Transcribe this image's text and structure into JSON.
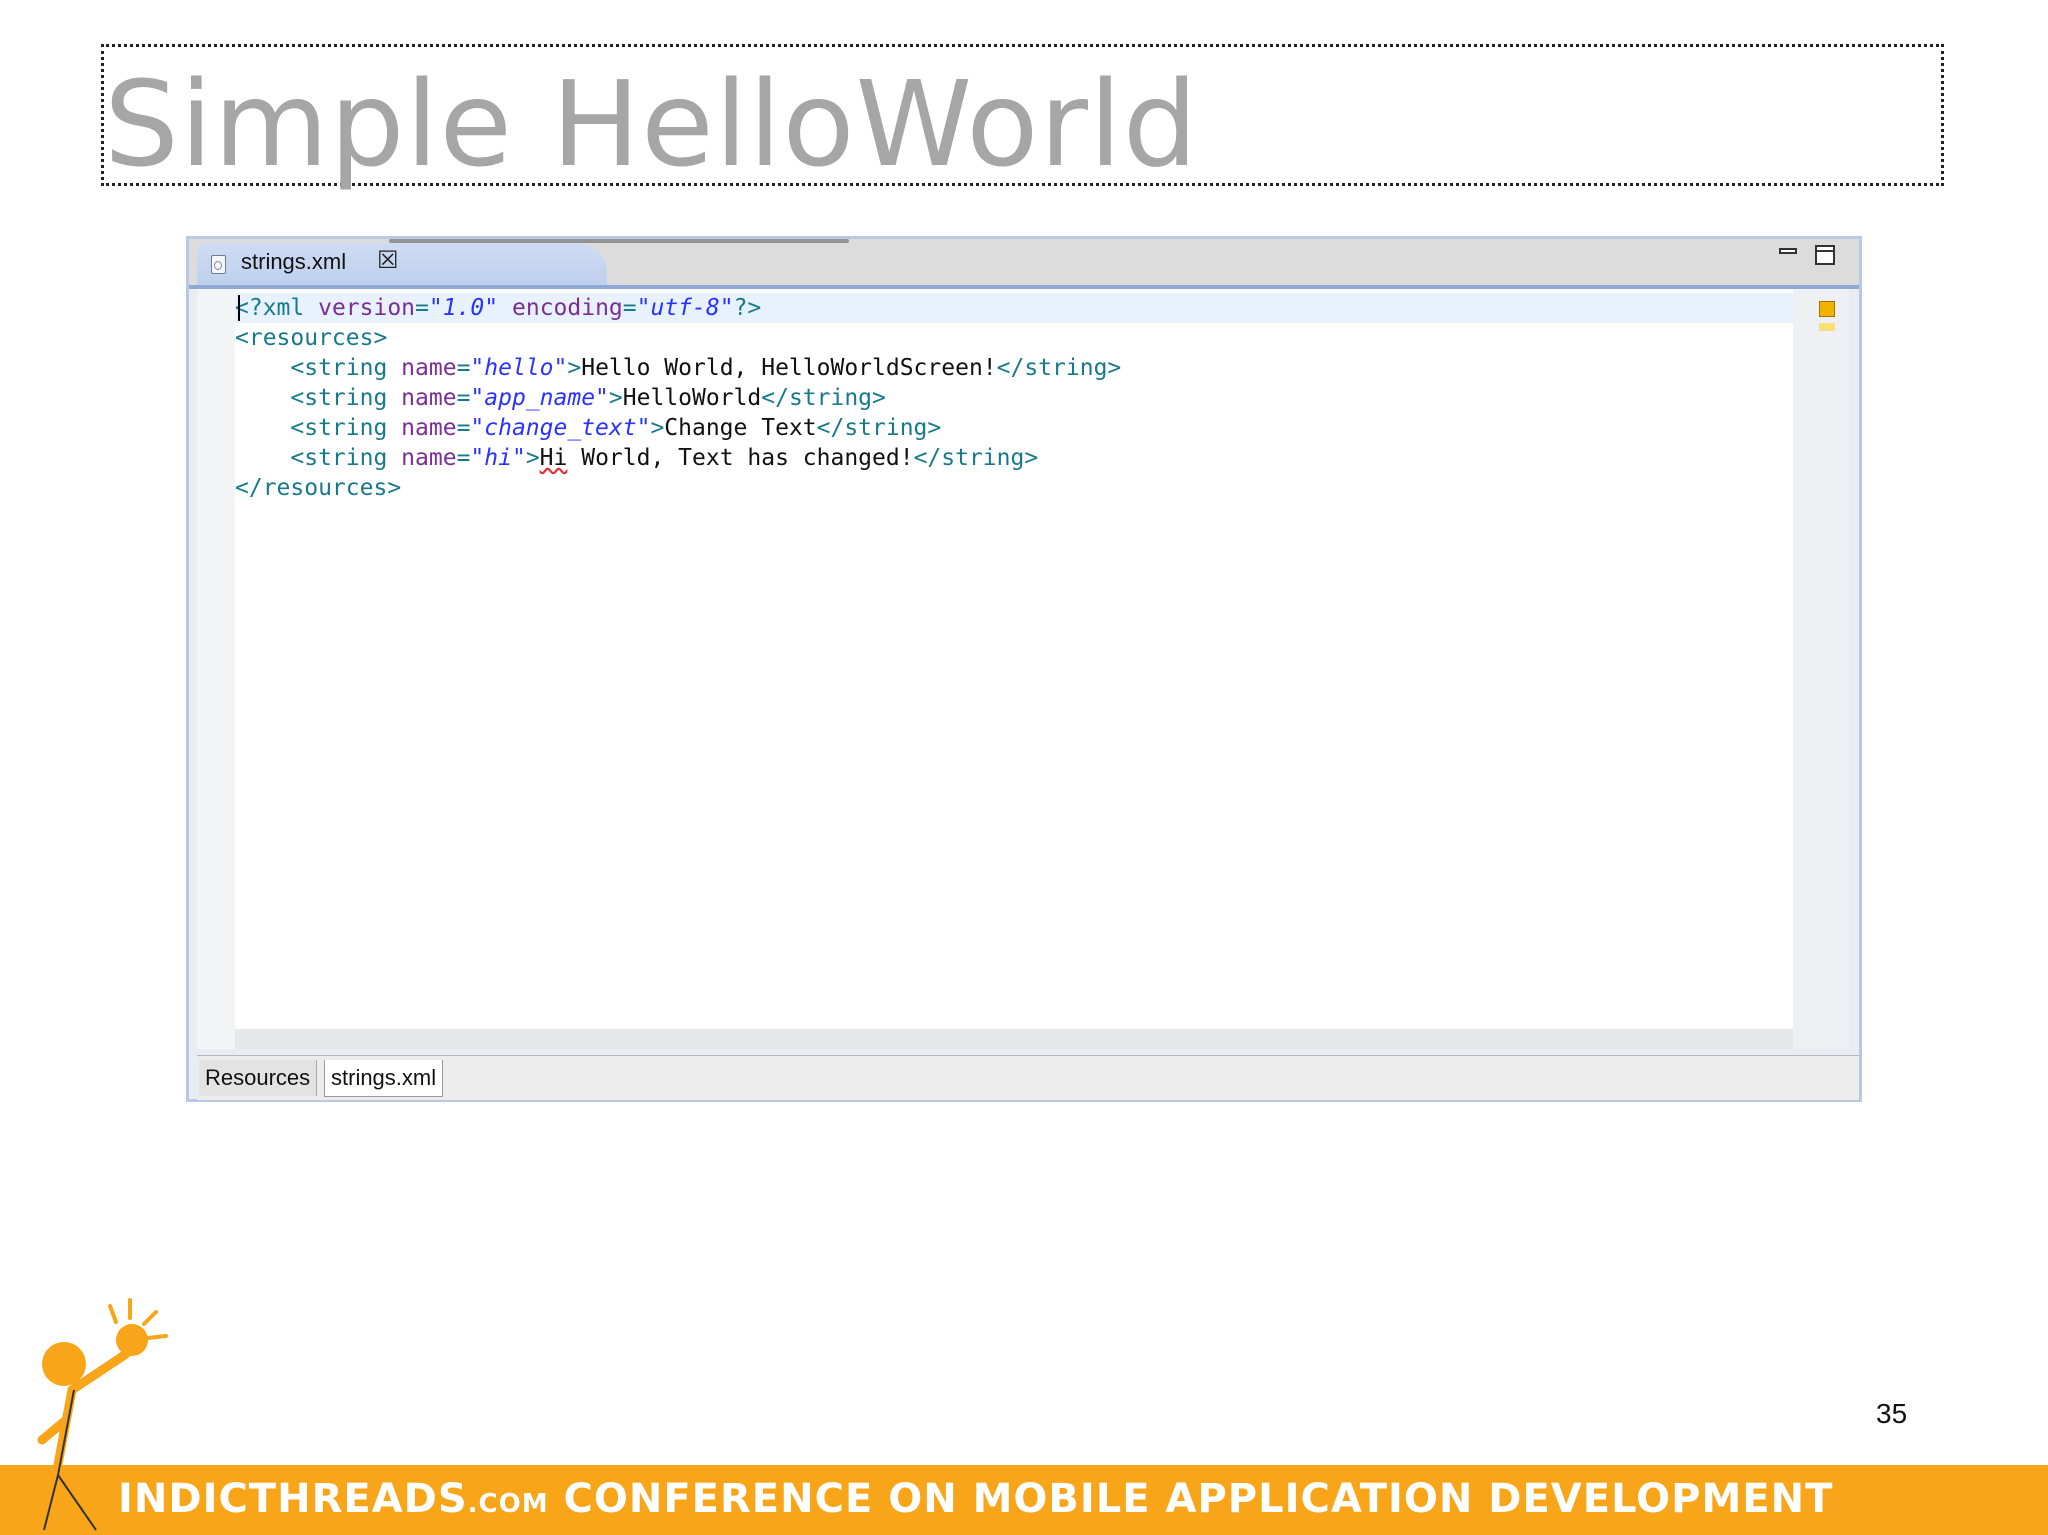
{
  "slide": {
    "title": "Simple HelloWorld",
    "page_number": "35"
  },
  "editor": {
    "tab_label": "strings.xml",
    "code_lines": [
      {
        "segments": [
          {
            "t": "<?xml ",
            "c": "tag"
          },
          {
            "t": "version",
            "c": "attr"
          },
          {
            "t": "=",
            "c": "tag"
          },
          {
            "t": "\"1.0\"",
            "c": "val"
          },
          {
            "t": " ",
            "c": "plain"
          },
          {
            "t": "encoding",
            "c": "attr"
          },
          {
            "t": "=",
            "c": "tag"
          },
          {
            "t": "\"utf-8\"",
            "c": "val"
          },
          {
            "t": "?>",
            "c": "tag"
          }
        ]
      },
      {
        "segments": [
          {
            "t": "<resources>",
            "c": "tag"
          }
        ]
      },
      {
        "segments": [
          {
            "t": "    <string ",
            "c": "tag"
          },
          {
            "t": "name",
            "c": "attr"
          },
          {
            "t": "=",
            "c": "tag"
          },
          {
            "t": "\"hello\"",
            "c": "val"
          },
          {
            "t": ">",
            "c": "tag"
          },
          {
            "t": "Hello World, HelloWorldScreen!",
            "c": "plain"
          },
          {
            "t": "</string>",
            "c": "tag"
          }
        ]
      },
      {
        "segments": [
          {
            "t": "    <string ",
            "c": "tag"
          },
          {
            "t": "name",
            "c": "attr"
          },
          {
            "t": "=",
            "c": "tag"
          },
          {
            "t": "\"app_name\"",
            "c": "val"
          },
          {
            "t": ">",
            "c": "tag"
          },
          {
            "t": "HelloWorld",
            "c": "plain"
          },
          {
            "t": "</string>",
            "c": "tag"
          }
        ]
      },
      {
        "segments": [
          {
            "t": "    <string ",
            "c": "tag"
          },
          {
            "t": "name",
            "c": "attr"
          },
          {
            "t": "=",
            "c": "tag"
          },
          {
            "t": "\"change_text\"",
            "c": "val"
          },
          {
            "t": ">",
            "c": "tag"
          },
          {
            "t": "Change Text",
            "c": "plain"
          },
          {
            "t": "</string>",
            "c": "tag"
          }
        ]
      },
      {
        "segments": [
          {
            "t": "    <string ",
            "c": "tag"
          },
          {
            "t": "name",
            "c": "attr"
          },
          {
            "t": "=",
            "c": "tag"
          },
          {
            "t": "\"hi\"",
            "c": "val"
          },
          {
            "t": ">",
            "c": "tag"
          },
          {
            "t": "Hi",
            "c": "squiggle"
          },
          {
            "t": " World, Text has changed!",
            "c": "plain"
          },
          {
            "t": "</string>",
            "c": "tag"
          }
        ]
      },
      {
        "segments": [
          {
            "t": "</resources>",
            "c": "tag"
          }
        ]
      }
    ]
  },
  "bottom_tabs": {
    "resources": "Resources",
    "strings_xml": "strings.xml"
  },
  "footer": {
    "brand": "IndicThreads",
    "brand_suffix": ".com",
    "tagline": " Conference On Mobile Application Development"
  },
  "colors": {
    "footer_bar": "#f9a51a",
    "title_text": "#a6a6a6",
    "xml_tag": "#177a8a",
    "xml_attribute": "#7a2f93",
    "xml_value": "#2a32ff"
  }
}
